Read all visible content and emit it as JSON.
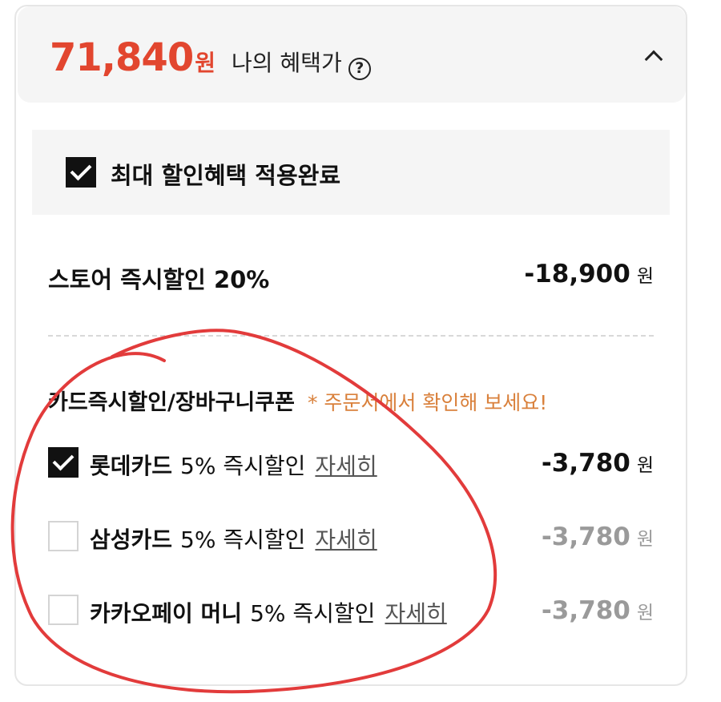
{
  "header": {
    "price": "71,840",
    "price_unit": "원",
    "label": "나의 혜택가",
    "help_glyph": "?"
  },
  "max_benefit": {
    "label": "최대 할인혜택 적용완료",
    "checked": true
  },
  "store_discount": {
    "label": "스토어 즉시할인 20%",
    "amount": "-18,900",
    "unit": "원"
  },
  "card_section": {
    "title": "카드즉시할인/장바구니쿠폰",
    "note": "* 주문서에서 확인해 보세요!",
    "items": [
      {
        "name": "롯데카드",
        "desc": "5% 즉시할인",
        "detail": "자세히",
        "amount": "-3,780",
        "unit": "원",
        "checked": true
      },
      {
        "name": "삼성카드",
        "desc": "5% 즉시할인",
        "detail": "자세히",
        "amount": "-3,780",
        "unit": "원",
        "checked": false
      },
      {
        "name": "카카오페이 머니",
        "desc": "5% 즉시할인",
        "detail": "자세히",
        "amount": "-3,780",
        "unit": "원",
        "checked": false
      }
    ]
  },
  "colors": {
    "price": "#e2462f",
    "note": "#d9803b",
    "annotation": "#e23b3b",
    "muted_amount": "#9a9a9a"
  }
}
